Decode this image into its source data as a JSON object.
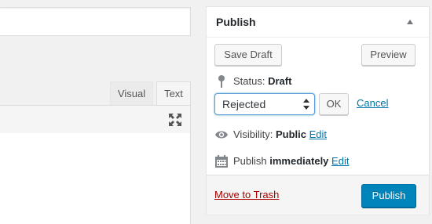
{
  "editor": {
    "tabs": [
      {
        "label": "Visual"
      },
      {
        "label": "Text"
      }
    ],
    "fullscreen_icon": "fullscreen-icon"
  },
  "publish_box": {
    "title": "Publish",
    "save_draft_label": "Save Draft",
    "preview_label": "Preview",
    "status": {
      "label": "Status:",
      "value": "Draft",
      "icon": "pin-icon",
      "selected_option": "Rejected",
      "ok_label": "OK",
      "cancel_label": "Cancel"
    },
    "visibility": {
      "label": "Visibility:",
      "value": "Public",
      "edit_label": "Edit",
      "icon": "eye-icon"
    },
    "schedule": {
      "label": "Publish",
      "value": "immediately",
      "edit_label": "Edit",
      "icon": "calendar-icon"
    },
    "move_to_trash_label": "Move to Trash",
    "publish_label": "Publish"
  },
  "colors": {
    "primary_button": "#0085ba",
    "link": "#0073aa",
    "trash_link": "#a00"
  }
}
